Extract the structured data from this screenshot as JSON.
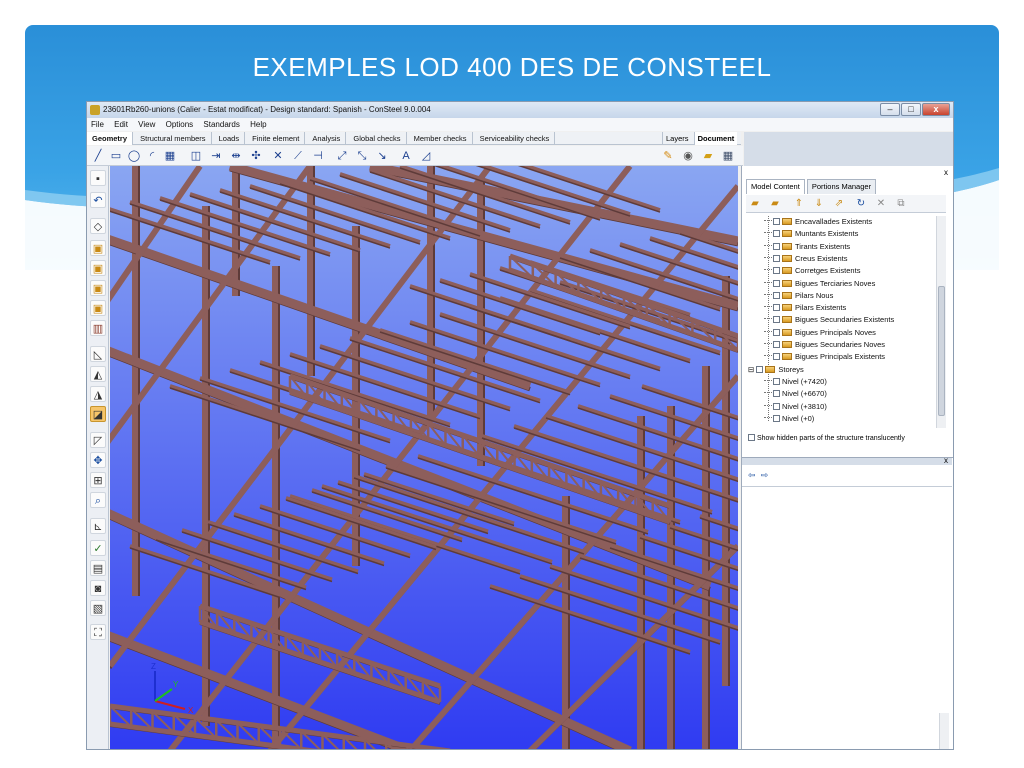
{
  "slide": {
    "title": "EXEMPLES  LOD 400 DES DE CONSTEEL"
  },
  "window": {
    "title": "23601Rb260-unions (Calier - Estat modificat) - Design standard: Spanish - ConSteel 9.0.004",
    "buttons": {
      "minimize": "–",
      "maximize": "□",
      "close": "x"
    }
  },
  "menu": [
    "File",
    "Edit",
    "View",
    "Options",
    "Standards",
    "Help"
  ],
  "tabs": [
    {
      "label": "Geometry",
      "active": true
    },
    {
      "label": "Structural members"
    },
    {
      "label": "Loads"
    },
    {
      "label": "Finite element"
    },
    {
      "label": "Analysis"
    },
    {
      "label": "Global checks"
    },
    {
      "label": "Member checks"
    },
    {
      "label": "Serviceability checks"
    }
  ],
  "right_tabs": [
    {
      "label": "Layers"
    },
    {
      "label": "Document",
      "active": true
    }
  ],
  "panel": {
    "close": "x",
    "tabs": [
      {
        "label": "Model Content",
        "active": true
      },
      {
        "label": "Portions Manager"
      }
    ],
    "tree": [
      "Encavallades Existents",
      "Muntants Existents",
      "Tirants Existents",
      "Creus Existents",
      "Corretges Existents",
      "Bigues Terciaries Noves",
      "Pilars Nous",
      "Pilars Existents",
      "Bigues Secundaries Existents",
      "Bigues Principals Noves",
      "Bigues Secundaries Noves",
      "Bigues Principals Existents"
    ],
    "storeys_label": "Storeys",
    "storeys": [
      "Nivel (+7420)",
      "Nivel (+6670)",
      "Nivel (+3810)",
      "Nivel (+0)"
    ],
    "show_hidden": "Show hidden parts of the structure translucently"
  },
  "bottom_panel": {
    "close": "x",
    "back": "⇦",
    "forward": "⇨"
  },
  "axes": {
    "x": "X",
    "y": "Y",
    "z": "Z"
  },
  "colors": {
    "steel": "#8d5e5b",
    "steel_dark": "#5e3b39",
    "sky_top": "#7fa0f0",
    "sky_bottom": "#2f3cf0",
    "header": "#2a8fd8"
  }
}
